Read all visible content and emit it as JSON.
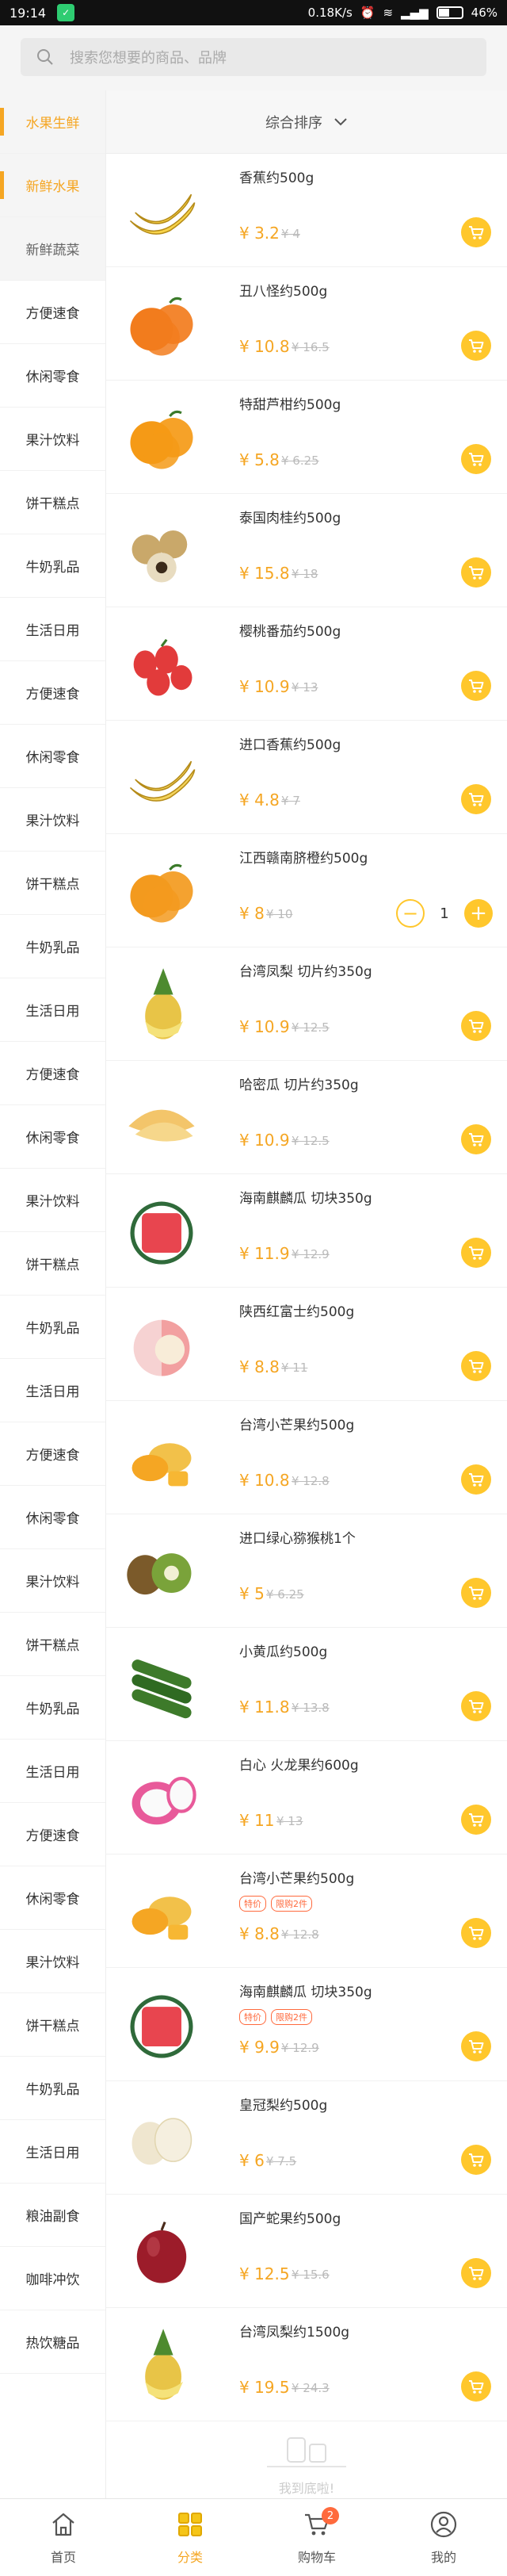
{
  "status": {
    "time": "19:14",
    "speed": "0.18K/s",
    "battery": "46%",
    "battery_level": 0.46
  },
  "search": {
    "placeholder": "搜索您想要的商品、品牌"
  },
  "sidebar": {
    "items": [
      {
        "label": "水果生鲜",
        "active": true,
        "sub": false
      },
      {
        "label": "新鲜水果",
        "active": true,
        "sub": true
      },
      {
        "label": "新鲜蔬菜",
        "active": false,
        "sub": true
      },
      {
        "label": "方便速食"
      },
      {
        "label": "休闲零食"
      },
      {
        "label": "果汁饮料"
      },
      {
        "label": "饼干糕点"
      },
      {
        "label": "牛奶乳品"
      },
      {
        "label": "生活日用"
      },
      {
        "label": "方便速食"
      },
      {
        "label": "休闲零食"
      },
      {
        "label": "果汁饮料"
      },
      {
        "label": "饼干糕点"
      },
      {
        "label": "牛奶乳品"
      },
      {
        "label": "生活日用"
      },
      {
        "label": "方便速食"
      },
      {
        "label": "休闲零食"
      },
      {
        "label": "果汁饮料"
      },
      {
        "label": "饼干糕点"
      },
      {
        "label": "牛奶乳品"
      },
      {
        "label": "生活日用"
      },
      {
        "label": "方便速食"
      },
      {
        "label": "休闲零食"
      },
      {
        "label": "果汁饮料"
      },
      {
        "label": "饼干糕点"
      },
      {
        "label": "牛奶乳品"
      },
      {
        "label": "生活日用"
      },
      {
        "label": "方便速食"
      },
      {
        "label": "休闲零食"
      },
      {
        "label": "果汁饮料"
      },
      {
        "label": "饼干糕点"
      },
      {
        "label": "牛奶乳品"
      },
      {
        "label": "生活日用"
      },
      {
        "label": "粮油副食"
      },
      {
        "label": "咖啡冲饮"
      },
      {
        "label": "热饮糖品"
      }
    ]
  },
  "sort": {
    "label": "综合排序"
  },
  "products": [
    {
      "name": "香蕉约500g",
      "price": "¥ 3.2",
      "old": "¥ 4",
      "fruit": "banana",
      "color": "#f7d34a"
    },
    {
      "name": "丑八怪约500g",
      "price": "¥ 10.8",
      "old": "¥ 16.5",
      "fruit": "orange",
      "color": "#f27c1d"
    },
    {
      "name": "特甜芦柑约500g",
      "price": "¥ 5.8",
      "old": "¥ 6.25",
      "fruit": "orange",
      "color": "#f59a16"
    },
    {
      "name": "泰国肉桂约500g",
      "price": "¥ 15.8",
      "old": "¥ 18",
      "fruit": "longan",
      "color": "#c9a86a"
    },
    {
      "name": "樱桃番茄约500g",
      "price": "¥ 10.9",
      "old": "¥ 13",
      "fruit": "tomato",
      "color": "#e23b3b"
    },
    {
      "name": "进口香蕉约500g",
      "price": "¥ 4.8",
      "old": "¥ 7",
      "fruit": "banana",
      "color": "#f3d35c"
    },
    {
      "name": "江西赣南脐橙约500g",
      "price": "¥ 8",
      "old": "¥ 10",
      "fruit": "orange",
      "color": "#f39a1e",
      "qty": "1"
    },
    {
      "name": "台湾凤梨 切片约350g",
      "price": "¥ 10.9",
      "old": "¥ 12.5",
      "fruit": "pineapple",
      "color": "#e8c447"
    },
    {
      "name": "哈密瓜 切片约350g",
      "price": "¥ 10.9",
      "old": "¥ 12.5",
      "fruit": "melon",
      "color": "#f3c56a"
    },
    {
      "name": "海南麒麟瓜 切块350g",
      "price": "¥ 11.9",
      "old": "¥ 12.9",
      "fruit": "watermelon",
      "color": "#e8454f"
    },
    {
      "name": "陕西红富士约500g",
      "price": "¥ 8.8",
      "old": "¥ 11",
      "fruit": "apple",
      "color": "#f2a0a0"
    },
    {
      "name": "台湾小芒果约500g",
      "price": "¥ 10.8",
      "old": "¥ 12.8",
      "fruit": "mango",
      "color": "#f2c14a"
    },
    {
      "name": "进口绿心猕猴桃1个",
      "price": "¥ 5",
      "old": "¥ 6.25",
      "fruit": "kiwi",
      "color": "#7aa33a"
    },
    {
      "name": "小黄瓜约500g",
      "price": "¥ 11.8",
      "old": "¥ 13.8",
      "fruit": "cucumber",
      "color": "#3d7a2a"
    },
    {
      "name": "白心 火龙果约600g",
      "price": "¥ 11",
      "old": "¥ 13",
      "fruit": "dragon",
      "color": "#e85a9a"
    },
    {
      "name": "台湾小芒果约500g",
      "price": "¥ 8.8",
      "old": "¥ 12.8",
      "fruit": "mango",
      "color": "#f2c14a",
      "tags": [
        "特价",
        "限购2件"
      ]
    },
    {
      "name": "海南麒麟瓜 切块350g",
      "price": "¥ 9.9",
      "old": "¥ 12.9",
      "fruit": "watermelon",
      "color": "#e8454f",
      "tags": [
        "特价",
        "限购2件"
      ]
    },
    {
      "name": "皇冠梨约500g",
      "price": "¥ 6",
      "old": "¥ 7.5",
      "fruit": "pear",
      "color": "#efe6cf"
    },
    {
      "name": "国产蛇果约500g",
      "price": "¥ 12.5",
      "old": "¥ 15.6",
      "fruit": "redapple",
      "color": "#9c1c2a"
    },
    {
      "name": "台湾凤梨约1500g",
      "price": "¥ 19.5",
      "old": "¥ 24.3",
      "fruit": "pineapple",
      "color": "#e8c447"
    }
  ],
  "end_note": "我到底啦!",
  "nav": {
    "items": [
      {
        "label": "首页",
        "icon": "home-icon"
      },
      {
        "label": "分类",
        "icon": "category-icon",
        "active": true
      },
      {
        "label": "购物车",
        "icon": "cart-icon",
        "badge": "2"
      },
      {
        "label": "我的",
        "icon": "user-icon"
      }
    ]
  },
  "colors": {
    "accent": "#f5a623",
    "cart": "#ffc72c"
  }
}
